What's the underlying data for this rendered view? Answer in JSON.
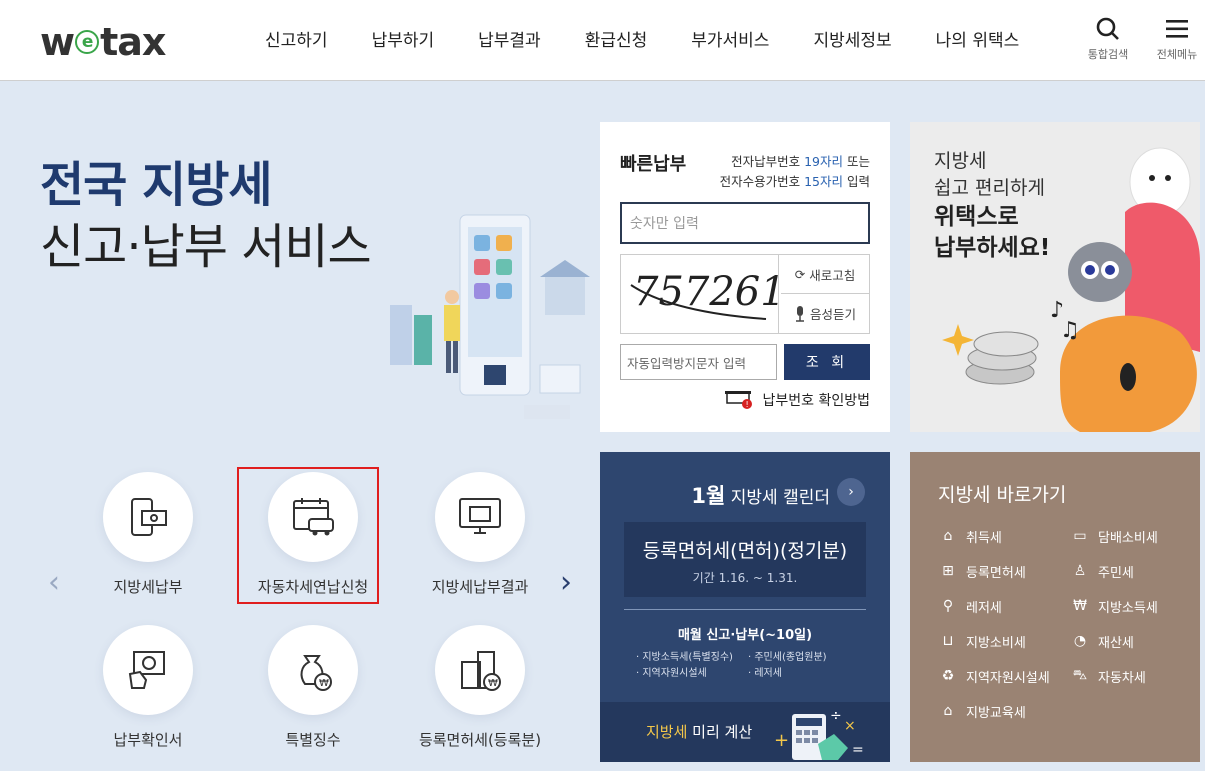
{
  "header": {
    "logo": "wetax",
    "nav": [
      "신고하기",
      "납부하기",
      "납부결과",
      "환급신청",
      "부가서비스",
      "지방세정보",
      "나의 위택스"
    ],
    "search_label": "통합검색",
    "menu_label": "전체메뉴"
  },
  "hero": {
    "title_line1": "전국 지방세",
    "title_line2": "신고·납부 서비스"
  },
  "quick_menu": [
    {
      "label": "지방세납부",
      "icon": "tax-payment-icon"
    },
    {
      "label": "자동차세연납신청",
      "icon": "car-tax-calendar-icon"
    },
    {
      "label": "지방세납부결과",
      "icon": "payment-result-icon"
    },
    {
      "label": "납부확인서",
      "icon": "payment-certificate-icon"
    },
    {
      "label": "특별징수",
      "icon": "special-collection-icon"
    },
    {
      "label": "등록면허세(등록분)",
      "icon": "registration-tax-icon"
    }
  ],
  "payment": {
    "title": "빠른납부",
    "desc_line1_prefix": "전자납부번호 ",
    "desc_line1_highlight": "19자리",
    "desc_line1_suffix": " 또는",
    "desc_line2_prefix": "전자수용가번호 ",
    "desc_line2_highlight": "15자리",
    "desc_line2_suffix": " 입력",
    "input_placeholder": "숫자만 입력",
    "captcha_text": "757261",
    "refresh_label": "새로고침",
    "audio_label": "음성듣기",
    "captcha_placeholder": "자동입력방지문자 입력",
    "submit_label": "조 회",
    "help_label": "납부번호 확인방법"
  },
  "promo": {
    "line1": "지방세",
    "line2": "쉽고 편리하게",
    "line3": "위택스로",
    "line4": "납부하세요!"
  },
  "calendar": {
    "month": "1월",
    "title": "지방세 캘린더",
    "event_title": "등록면허세(면허)(정기분)",
    "event_period": "기간 1.16. ~ 1.31.",
    "monthly_title": "매월 신고·납부(~10일)",
    "monthly_items": [
      "· 지방소득세(특별징수)",
      "· 주민세(종업원분)",
      "· 지역자원시설세",
      "· 레저세"
    ],
    "footer_highlight": "지방세",
    "footer_text": " 미리 계산"
  },
  "shortcut": {
    "title": "지방세 바로가기",
    "items": [
      {
        "label": "취득세",
        "icon": "building-icon"
      },
      {
        "label": "담배소비세",
        "icon": "cigarette-icon"
      },
      {
        "label": "등록면허세",
        "icon": "license-icon"
      },
      {
        "label": "주민세",
        "icon": "person-icon"
      },
      {
        "label": "레저세",
        "icon": "bicycle-icon"
      },
      {
        "label": "지방소득세",
        "icon": "money-bag-icon"
      },
      {
        "label": "지방소비세",
        "icon": "cart-icon"
      },
      {
        "label": "재산세",
        "icon": "pie-chart-icon"
      },
      {
        "label": "지역자원시설세",
        "icon": "recycle-icon"
      },
      {
        "label": "자동차세",
        "icon": "car-icon"
      },
      {
        "label": "지방교육세",
        "icon": "graduation-cap-icon"
      }
    ]
  }
}
